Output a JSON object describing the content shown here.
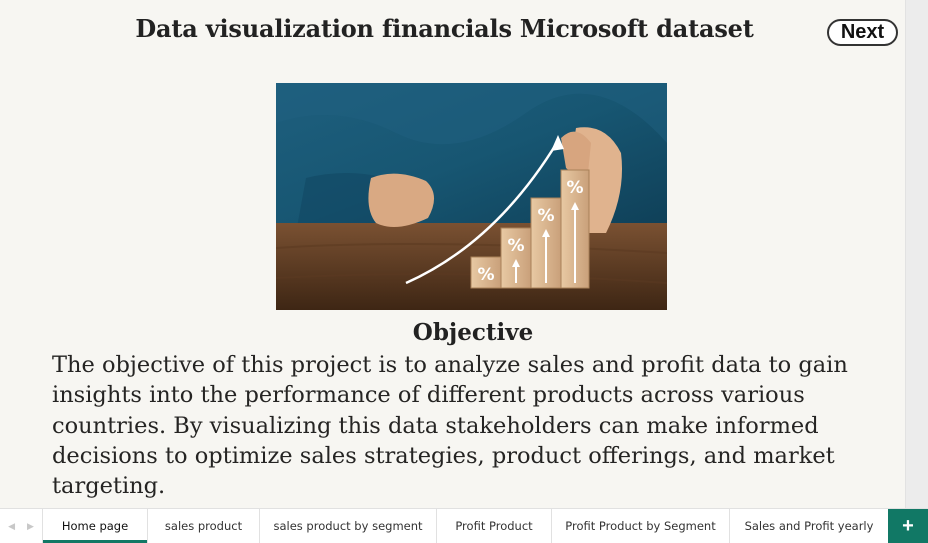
{
  "header": {
    "title": "Data visualization financials Microsoft dataset",
    "next_label": "Next"
  },
  "hero": {
    "block_labels": [
      "%",
      "%",
      "%",
      "%"
    ]
  },
  "objective": {
    "heading": "Objective",
    "lines": [
      "The objective of this project is to analyze sales and profit data to gain",
      "insights into the performance of different products across various",
      "countries. By visualizing this data stakeholders can make informed",
      "decisions to optimize sales strategies, product offerings, and market",
      "targeting."
    ]
  },
  "tabs": {
    "items": [
      {
        "label": "Home page"
      },
      {
        "label": "sales product"
      },
      {
        "label": "sales product by segment"
      },
      {
        "label": "Profit Product"
      },
      {
        "label": "Profit Product by Segment"
      },
      {
        "label": "Sales and Profit yearly"
      }
    ],
    "add_label": "+",
    "prev_arrow": "◀",
    "next_arrow": "▶"
  },
  "colors": {
    "accent": "#117865",
    "background": "#f7f6f2"
  }
}
